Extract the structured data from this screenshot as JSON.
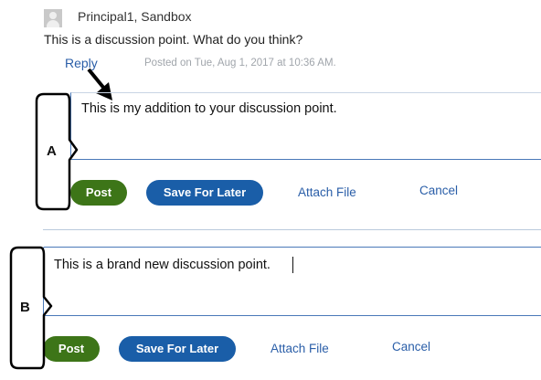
{
  "post": {
    "author": "Principal1, Sandbox",
    "text": "This is a discussion point. What do you think?",
    "reply_label": "Reply",
    "posted_on": "Posted on Tue, Aug 1, 2017 at 10:36 AM."
  },
  "reply_form": {
    "value": "This is my addition to your discussion point.",
    "post_label": "Post",
    "save_label": "Save For Later",
    "attach_label": "Attach File",
    "cancel_label": "Cancel",
    "annotation": "A"
  },
  "new_form": {
    "value": "This is a brand new discussion point.",
    "post_label": "Post",
    "save_label": "Save For Later",
    "attach_label": "Attach File",
    "cancel_label": "Cancel",
    "annotation": "B"
  },
  "colors": {
    "post_button": "#3d7518",
    "save_button": "#1a5ea8",
    "link": "#2a5ea8",
    "input_border": "#4a79b8"
  }
}
